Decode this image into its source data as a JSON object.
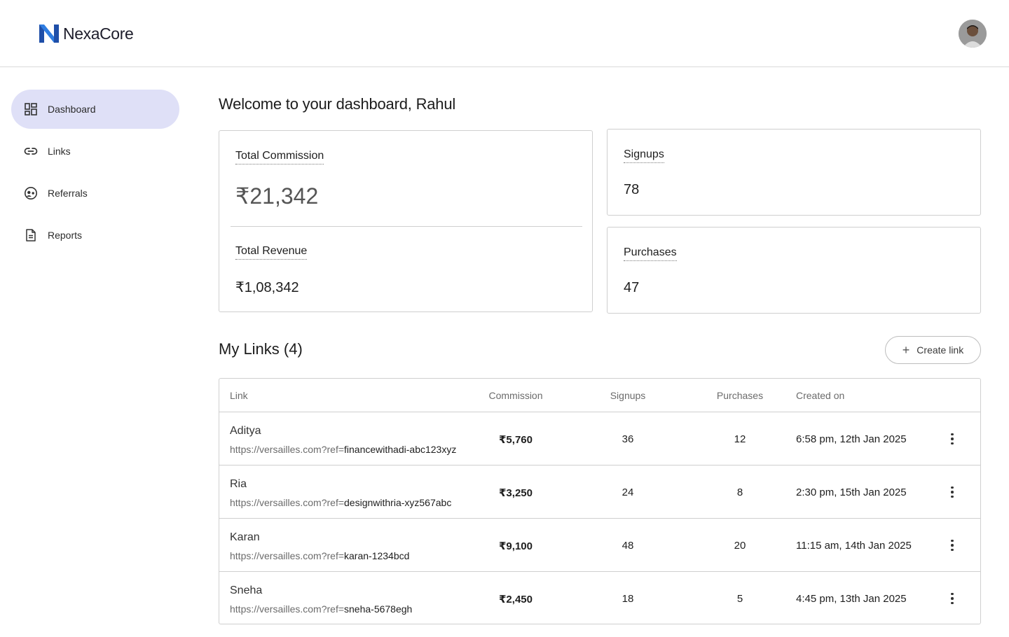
{
  "app": {
    "brand": "NexaCore",
    "accent": "#dfe0f7"
  },
  "sidebar": {
    "items": [
      {
        "label": "Dashboard",
        "icon": "dashboard-icon",
        "active": true
      },
      {
        "label": "Links",
        "icon": "link-icon"
      },
      {
        "label": "Referrals",
        "icon": "referrals-icon"
      },
      {
        "label": "Reports",
        "icon": "document-icon"
      }
    ]
  },
  "main": {
    "welcome": "Welcome to your dashboard, Rahul",
    "metrics": {
      "total_commission_label": "Total Commission",
      "total_commission_value": "₹21,342",
      "total_revenue_label": "Total Revenue",
      "total_revenue_value": "₹1,08,342",
      "signups_label": "Signups",
      "signups_value": "78",
      "purchases_label": "Purchases",
      "purchases_value": "47"
    },
    "links_title": "My Links (4)",
    "create_link_label": "Create link",
    "table": {
      "headers": [
        "Link",
        "Commission",
        "Signups",
        "Purchases",
        "Created on"
      ],
      "rows": [
        {
          "name": "Aditya",
          "url_base": "https://versailles.com?ref=",
          "ref": "financewithadi-abc123xyz",
          "commission": "₹5,760",
          "signups": "36",
          "purchases": "12",
          "created": "6:58 pm, 12th Jan 2025"
        },
        {
          "name": "Ria",
          "url_base": "https://versailles.com?ref=",
          "ref": "designwithria-xyz567abc",
          "commission": "₹3,250",
          "signups": "24",
          "purchases": "8",
          "created": "2:30 pm, 15th Jan 2025"
        },
        {
          "name": "Karan",
          "url_base": "https://versailles.com?ref=",
          "ref": "karan-1234bcd",
          "commission": "₹9,100",
          "signups": "48",
          "purchases": "20",
          "created": "11:15 am, 14th Jan 2025"
        },
        {
          "name": "Sneha",
          "url_base": "https://versailles.com?ref=",
          "ref": "sneha-5678egh",
          "commission": "₹2,450",
          "signups": "18",
          "purchases": "5",
          "created": "4:45 pm, 13th Jan 2025"
        }
      ]
    }
  }
}
